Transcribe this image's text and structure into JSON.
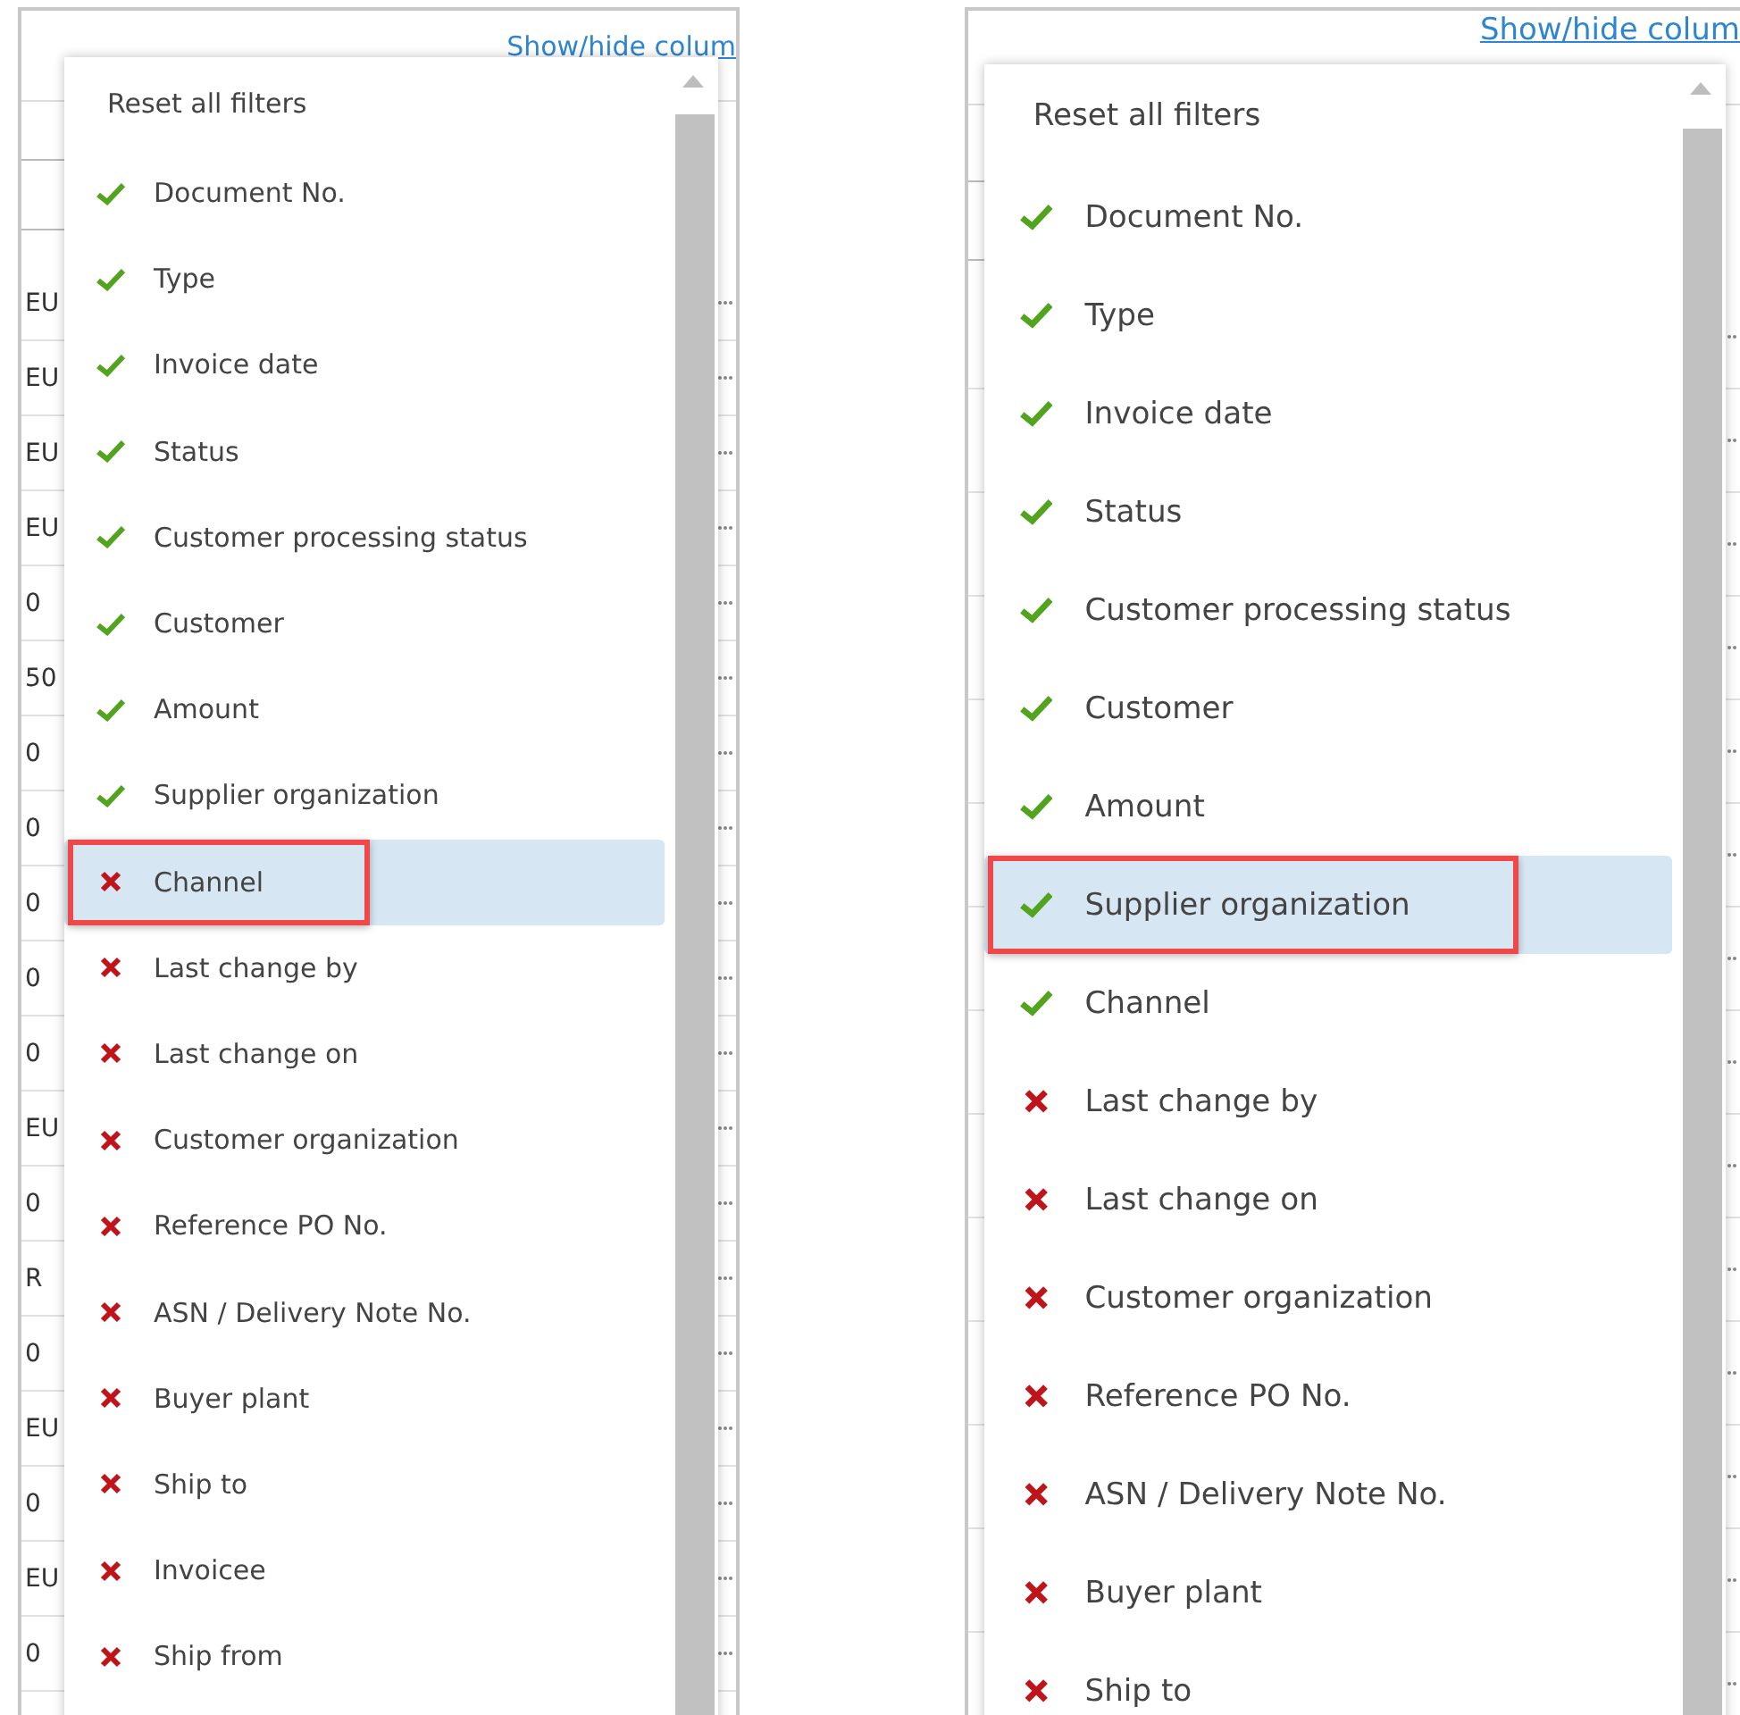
{
  "panels": [
    {
      "link": "Show/hide colum",
      "table_cells": [
        "EU",
        "EU",
        "EU",
        "EU",
        "0",
        "50",
        "0",
        "0",
        "0",
        "0",
        "0",
        "EU",
        "0",
        "R",
        "0",
        "EU",
        "0",
        "EU",
        "0"
      ],
      "menu": {
        "reset": "Reset all filters",
        "items": [
          {
            "label": "Document No.",
            "checked": true,
            "selected": false,
            "callout": false
          },
          {
            "label": "Type",
            "checked": true,
            "selected": false,
            "callout": false
          },
          {
            "label": "Invoice date",
            "checked": true,
            "selected": false,
            "callout": false
          },
          {
            "label": "Status",
            "checked": true,
            "selected": false,
            "callout": false
          },
          {
            "label": "Customer processing status",
            "checked": true,
            "selected": false,
            "callout": false
          },
          {
            "label": "Customer",
            "checked": true,
            "selected": false,
            "callout": false
          },
          {
            "label": "Amount",
            "checked": true,
            "selected": false,
            "callout": false
          },
          {
            "label": "Supplier organization",
            "checked": true,
            "selected": false,
            "callout": false
          },
          {
            "label": "Channel",
            "checked": false,
            "selected": true,
            "callout": true
          },
          {
            "label": "Last change by",
            "checked": false,
            "selected": false,
            "callout": false
          },
          {
            "label": "Last change on",
            "checked": false,
            "selected": false,
            "callout": false
          },
          {
            "label": "Customer organization",
            "checked": false,
            "selected": false,
            "callout": false
          },
          {
            "label": "Reference PO No.",
            "checked": false,
            "selected": false,
            "callout": false
          },
          {
            "label": "ASN / Delivery Note No.",
            "checked": false,
            "selected": false,
            "callout": false
          },
          {
            "label": "Buyer plant",
            "checked": false,
            "selected": false,
            "callout": false
          },
          {
            "label": "Ship to",
            "checked": false,
            "selected": false,
            "callout": false
          },
          {
            "label": "Invoicee",
            "checked": false,
            "selected": false,
            "callout": false
          },
          {
            "label": "Ship from",
            "checked": false,
            "selected": false,
            "callout": false
          }
        ]
      }
    },
    {
      "link": "Show/hide colum",
      "menu": {
        "reset": "Reset all filters",
        "items": [
          {
            "label": "Document No.",
            "checked": true,
            "selected": false,
            "callout": false
          },
          {
            "label": "Type",
            "checked": true,
            "selected": false,
            "callout": false
          },
          {
            "label": "Invoice date",
            "checked": true,
            "selected": false,
            "callout": false
          },
          {
            "label": "Status",
            "checked": true,
            "selected": false,
            "callout": false
          },
          {
            "label": "Customer processing status",
            "checked": true,
            "selected": false,
            "callout": false
          },
          {
            "label": "Customer",
            "checked": true,
            "selected": false,
            "callout": false
          },
          {
            "label": "Amount",
            "checked": true,
            "selected": false,
            "callout": false
          },
          {
            "label": "Supplier organization",
            "checked": true,
            "selected": true,
            "callout": true
          },
          {
            "label": "Channel",
            "checked": true,
            "selected": false,
            "callout": false
          },
          {
            "label": "Last change by",
            "checked": false,
            "selected": false,
            "callout": false
          },
          {
            "label": "Last change on",
            "checked": false,
            "selected": false,
            "callout": false
          },
          {
            "label": "Customer organization",
            "checked": false,
            "selected": false,
            "callout": false
          },
          {
            "label": "Reference PO No.",
            "checked": false,
            "selected": false,
            "callout": false
          },
          {
            "label": "ASN / Delivery Note No.",
            "checked": false,
            "selected": false,
            "callout": false
          },
          {
            "label": "Buyer plant",
            "checked": false,
            "selected": false,
            "callout": false
          },
          {
            "label": "Ship to",
            "checked": false,
            "selected": false,
            "callout": false
          }
        ]
      }
    }
  ]
}
